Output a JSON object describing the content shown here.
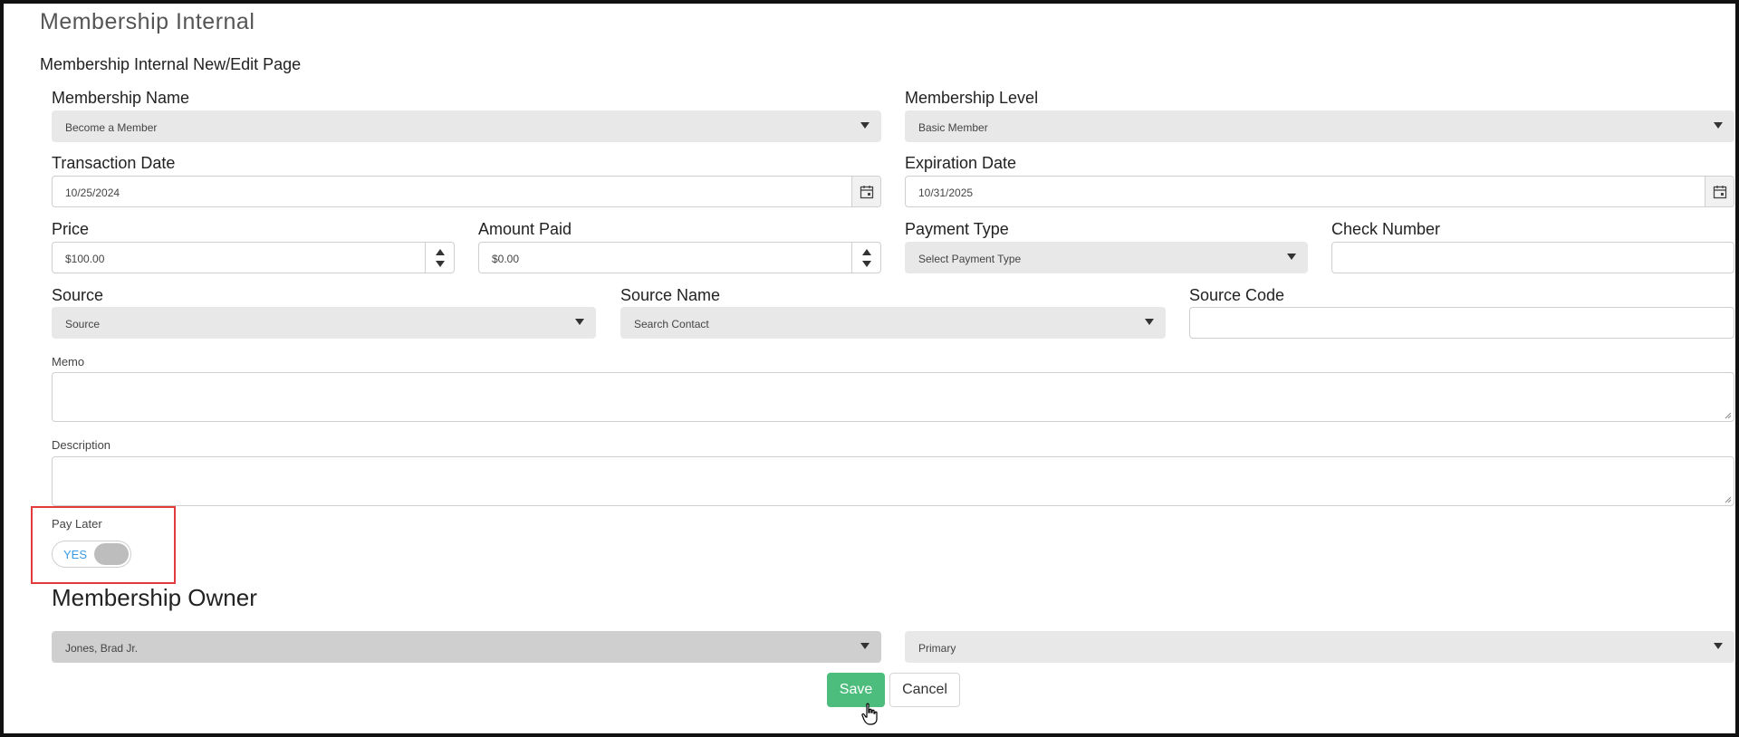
{
  "page": {
    "title": "Membership Internal",
    "subtitle": "Membership Internal New/Edit Page"
  },
  "form": {
    "membership_name": {
      "label": "Membership Name",
      "value": "Become a Member"
    },
    "membership_level": {
      "label": "Membership Level",
      "value": "Basic Member"
    },
    "transaction_date": {
      "label": "Transaction Date",
      "value": "10/25/2024"
    },
    "expiration_date": {
      "label": "Expiration Date",
      "value": "10/31/2025"
    },
    "price": {
      "label": "Price",
      "value": "$100.00"
    },
    "amount_paid": {
      "label": "Amount Paid",
      "value": "$0.00"
    },
    "payment_type": {
      "label": "Payment Type",
      "value": "Select Payment Type"
    },
    "check_number": {
      "label": "Check Number",
      "value": ""
    },
    "source": {
      "label": "Source",
      "value": "Source"
    },
    "source_name": {
      "label": "Source Name",
      "value": "Search Contact"
    },
    "source_code": {
      "label": "Source Code",
      "value": ""
    },
    "memo": {
      "label": "Memo",
      "value": ""
    },
    "description": {
      "label": "Description",
      "value": ""
    },
    "pay_later": {
      "label": "Pay Later",
      "state_text": "YES",
      "on": true
    }
  },
  "owner": {
    "section_title": "Membership Owner",
    "contact": "Jones, Brad Jr.",
    "role": "Primary"
  },
  "actions": {
    "save": "Save",
    "cancel": "Cancel"
  },
  "colors": {
    "save_button": "#4dbd7e",
    "toggle_text": "#3a9be0",
    "highlight": "#e23b3b"
  }
}
